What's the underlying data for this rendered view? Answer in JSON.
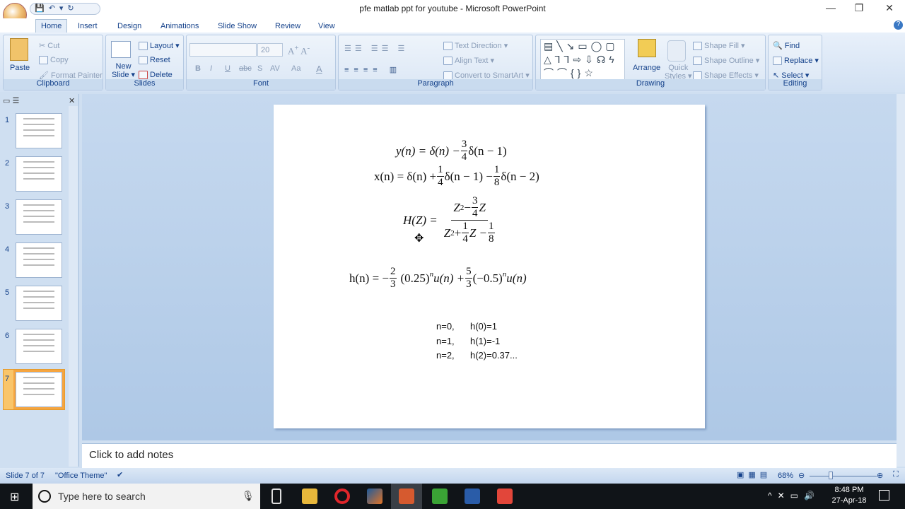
{
  "window": {
    "title": "pfe matlab ppt for youtube - Microsoft PowerPoint",
    "minimize": "—",
    "maximize": "❐",
    "close": "✕"
  },
  "qat": {
    "icons": "💾↶▾↻"
  },
  "tabs": [
    "Home",
    "Insert",
    "Design",
    "Animations",
    "Slide Show",
    "Review",
    "View"
  ],
  "ribbon": {
    "clipboard": {
      "label": "Clipboard",
      "paste": "Paste",
      "cut": "Cut",
      "copy": "Copy",
      "format_painter": "Format Painter"
    },
    "slides": {
      "label": "Slides",
      "new_slide": "New",
      "new_slide2": "Slide ▾",
      "layout": "Layout ▾",
      "reset": "Reset",
      "delete": "Delete"
    },
    "font": {
      "label": "Font",
      "font_name": "",
      "font_size": "20",
      "bold": "B",
      "italic": "I",
      "underline": "U",
      "strike": "abc",
      "shadow": "S",
      "spacing": "AV",
      "case": "Aa",
      "color": "A"
    },
    "paragraph": {
      "label": "Paragraph",
      "text_direction": "Text Direction ▾",
      "align_text": "Align Text ▾",
      "convert_smartart": "Convert to SmartArt ▾"
    },
    "drawing": {
      "label": "Drawing",
      "arrange": "Arrange",
      "quick_styles": "Quick",
      "quick_styles2": "Styles ▾",
      "shape_fill": "Shape Fill ▾",
      "shape_outline": "Shape Outline ▾",
      "shape_effects": "Shape Effects ▾",
      "shapes": "▤╲↘▭◯▢△⅂⅂⇨⇩☊ϟ⌒⌒{}☆"
    },
    "editing": {
      "label": "Editing",
      "find": "Find",
      "replace": "Replace ▾",
      "select": "Select ▾"
    }
  },
  "thumbnails": [
    "1",
    "2",
    "3",
    "4",
    "5",
    "6",
    "7"
  ],
  "selected_slide": 7,
  "slide": {
    "eq1": {
      "lhs": "y(n) = δ(n) −",
      "f": [
        "3",
        "4"
      ],
      "rhs": "δ(n − 1)"
    },
    "eq2": {
      "a": "x(n) = δ(n) +",
      "f1": [
        "1",
        "4"
      ],
      "b": "δ(n − 1) −",
      "f2": [
        "1",
        "8"
      ],
      "c": "δ(n − 2)"
    },
    "eq3": {
      "lhs": "H(Z) =",
      "num_a": "Z",
      "num_sup": "2",
      "num_b": " −",
      "num_f": [
        "3",
        "4"
      ],
      "num_c": "Z",
      "den_a": "Z",
      "den_sup": "2",
      "den_b": " +",
      "den_f1": [
        "1",
        "4"
      ],
      "den_c": "Z −",
      "den_f2": [
        "1",
        "8"
      ]
    },
    "eq4": {
      "a": "h(n) = −",
      "f1": [
        "2",
        "3"
      ],
      "b": "(0.25)",
      "sup1": "n",
      "c": "u(n) +",
      "f2": [
        "5",
        "3"
      ],
      "d": "(−0.5)",
      "sup2": "n",
      "e": "u(n)"
    },
    "values": [
      [
        "n=0,",
        "h(0)=1"
      ],
      [
        "n=1,",
        "h(1)=-1"
      ],
      [
        "n=2,",
        "h(2)=0.37..."
      ]
    ]
  },
  "notes": {
    "placeholder": "Click to add notes"
  },
  "status": {
    "slide": "Slide 7 of 7",
    "theme": "\"Office Theme\"",
    "zoom": "68%"
  },
  "taskbar": {
    "search_placeholder": "Type here to search",
    "time": "8:48 PM",
    "date": "27-Apr-18"
  }
}
